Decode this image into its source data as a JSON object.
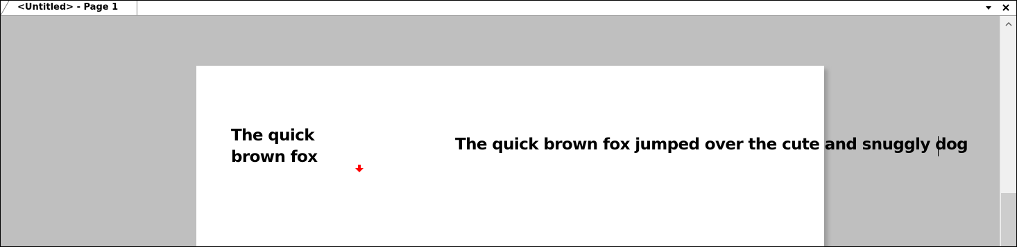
{
  "tab": {
    "title": "<Untitled> - Page 1"
  },
  "icons": {
    "tab_menu": "dropdown-arrow-icon",
    "tab_close": "close-icon",
    "scroll_up": "chevron-up-icon",
    "drop_marker": "red-down-arrow-icon"
  },
  "document": {
    "text_box_1": "The quick brown fox",
    "text_box_2": "The quick brown fox jumped over the cute and snuggly dog"
  },
  "colors": {
    "canvas_background": "#bfbfbf",
    "page_background": "#ffffff",
    "marker": "#ff0000"
  }
}
